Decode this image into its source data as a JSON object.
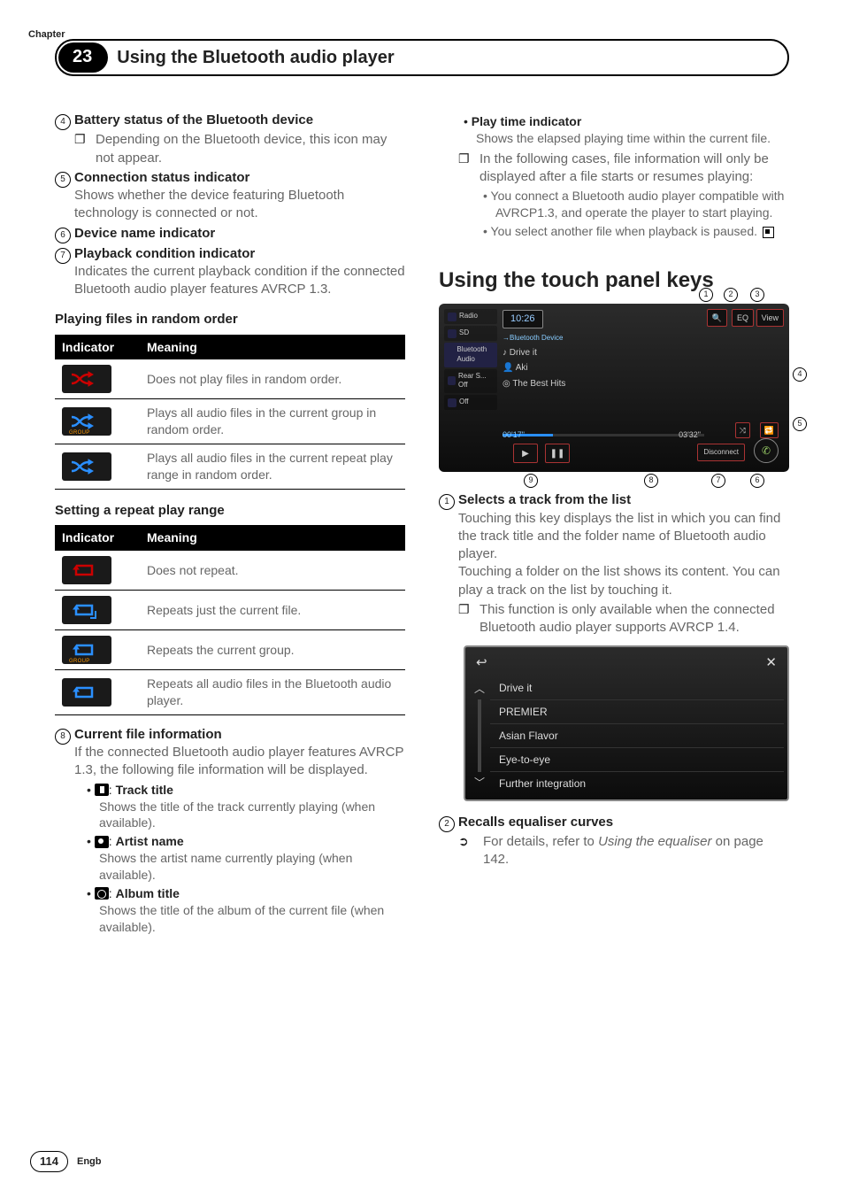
{
  "chapter_label": "Chapter",
  "chapter_num": "23",
  "chapter_title": "Using the Bluetooth audio player",
  "left": {
    "i4": {
      "title": "Battery status of the Bluetooth device",
      "note_bullet": "❐",
      "note": "Depending on the Bluetooth device, this icon may not appear."
    },
    "i5": {
      "title": "Connection status indicator",
      "body": "Shows whether the device featuring Bluetooth technology is connected or not."
    },
    "i6": {
      "title": "Device name indicator"
    },
    "i7": {
      "title": "Playback condition indicator",
      "body": "Indicates the current playback condition if the connected Bluetooth audio player features AVRCP 1.3."
    },
    "tbl1": {
      "caption": "Playing files in random order",
      "h1": "Indicator",
      "h2": "Meaning",
      "r1": "Does not play files in random order.",
      "r2": "Plays all audio files in the current group in random order.",
      "r3": "Plays all audio files in the current repeat play range in random order."
    },
    "tbl2": {
      "caption": "Setting a repeat play range",
      "h1": "Indicator",
      "h2": "Meaning",
      "r1": "Does not repeat.",
      "r2": "Repeats just the current file.",
      "r3": "Repeats the current group.",
      "r4": "Repeats all audio files in the Bluetooth audio player."
    },
    "i8": {
      "title": "Current file information",
      "body": "If the connected Bluetooth audio player features AVRCP 1.3, the following file information will be displayed.",
      "a": {
        "label": "Track title",
        "body": "Shows the title of the track currently playing (when available)."
      },
      "b": {
        "label": "Artist name",
        "body": "Shows the artist name currently playing (when available)."
      },
      "c": {
        "label": "Album title",
        "body": "Shows the title of the album of the current file (when available)."
      }
    }
  },
  "right": {
    "pti": {
      "label": "Play time indicator",
      "body": "Shows the elapsed playing time within the current file."
    },
    "note": {
      "bullet": "❐",
      "body": "In the following cases, file information will only be displayed after a file starts or resumes playing:",
      "a": "You connect a Bluetooth audio player compatible with AVRCP1.3, and operate the player to start playing.",
      "b": "You select another file when playback is paused."
    },
    "h2": "Using the touch panel keys",
    "fig": {
      "side": [
        "Radio",
        "SD",
        "Bluetooth Audio",
        "Rear S... Off",
        "Off"
      ],
      "time": "10:26",
      "crumb": "→Bluetooth Device",
      "t1": "Drive it",
      "t2": "Aki",
      "t3": "The Best Hits",
      "btn_search": "🔍",
      "btn_eq": "EQ",
      "btn_view": "View",
      "progress_l": "00'17\"",
      "progress_r": "03'32\"",
      "btn_play": "▶",
      "btn_pause": "❚❚",
      "btn_disc": "Disconnect"
    },
    "list": [
      "Drive it",
      "PREMIER",
      "Asian Flavor",
      "Eye-to-eye",
      "Further integration"
    ],
    "i1": {
      "title": "Selects a track from the list",
      "body1": "Touching this key displays the list in which you can find the track title and the folder name of Bluetooth audio player.",
      "body2": "Touching a folder on the list shows its content. You can play a track on the list by touching it.",
      "note_bullet": "❐",
      "note": "This function is only available when the connected Bluetooth audio player supports AVRCP 1.4."
    },
    "i2": {
      "title": "Recalls equaliser curves",
      "ref_pre": "For details, refer to ",
      "ref_it": "Using the equaliser",
      "ref_post": " on page 142."
    }
  },
  "page_num": "114",
  "lang": "Engb",
  "group_label": "GROUP"
}
